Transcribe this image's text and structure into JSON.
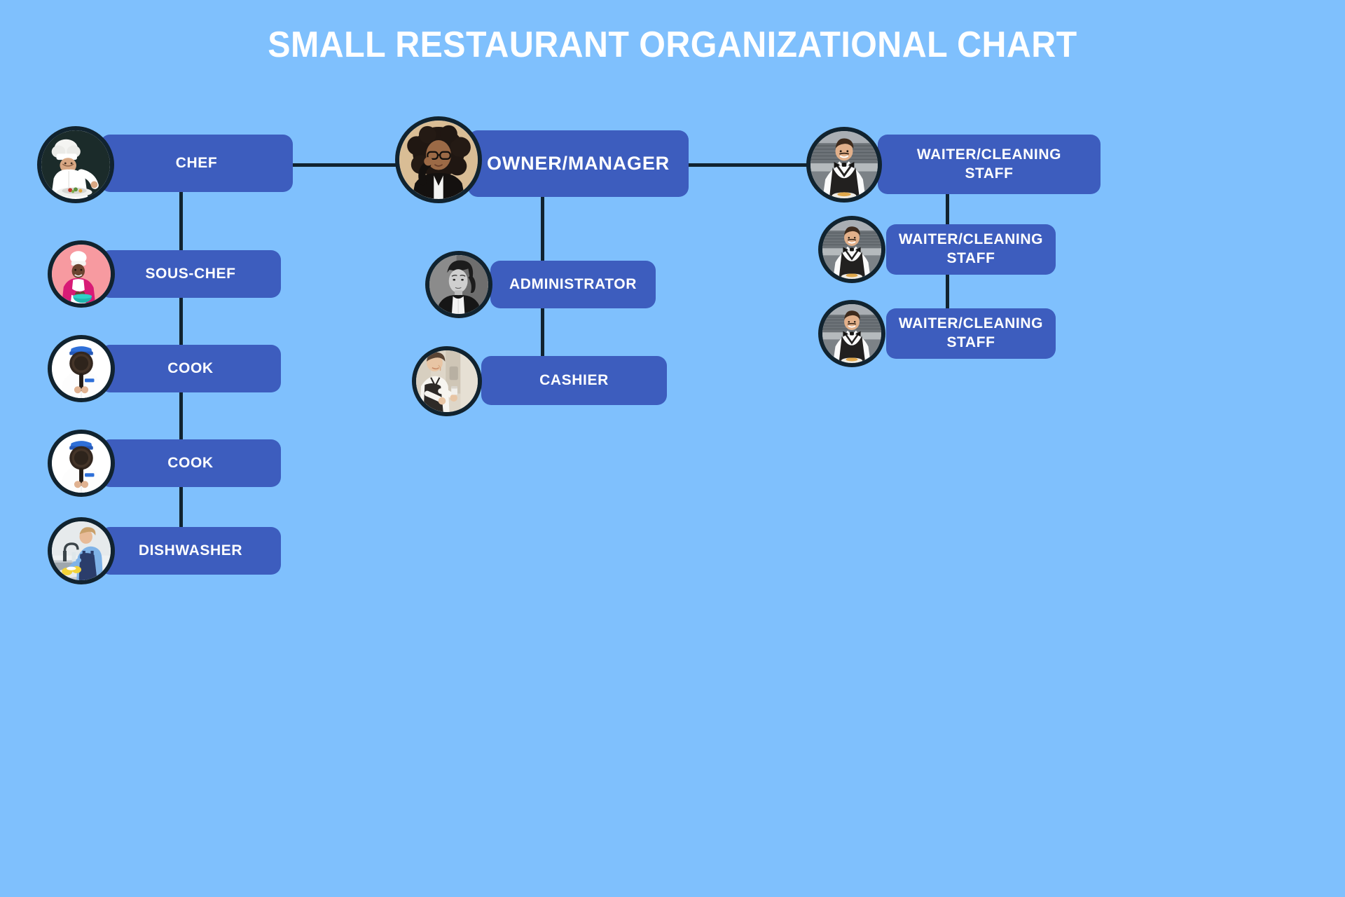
{
  "title": "SMALL RESTAURANT ORGANIZATIONAL CHART",
  "colors": {
    "background": "#7fc0fd",
    "box": "#3d5dbe",
    "connector": "#11232f",
    "label_text": "#ffffff",
    "title_text": "#ffffff",
    "avatar_ring": "#11232f"
  },
  "nodes": {
    "owner": {
      "label": "OWNER/MANAGER",
      "avatar": "owner-manager-photo"
    },
    "chef": {
      "label": "CHEF",
      "avatar": "chef-photo"
    },
    "sous_chef": {
      "label": "SOUS-CHEF",
      "avatar": "sous-chef-photo"
    },
    "cook1": {
      "label": "COOK",
      "avatar": "cook-photo"
    },
    "cook2": {
      "label": "COOK",
      "avatar": "cook-photo"
    },
    "dishwasher": {
      "label": "DISHWASHER",
      "avatar": "dishwasher-photo"
    },
    "administrator": {
      "label": "ADMINISTRATOR",
      "avatar": "administrator-photo"
    },
    "cashier": {
      "label": "CASHIER",
      "avatar": "cashier-photo"
    },
    "waiter1": {
      "label": "WAITER/CLEANING\nSTAFF",
      "avatar": "waiter-photo"
    },
    "waiter2": {
      "label": "WAITER/CLEANING\nSTAFF",
      "avatar": "waiter-photo"
    },
    "waiter3": {
      "label": "WAITER/CLEANING\nSTAFF",
      "avatar": "waiter-photo"
    }
  },
  "chart_data": {
    "type": "orgchart",
    "root": "OWNER/MANAGER",
    "branches": [
      {
        "head": "CHEF",
        "reports": [
          "SOUS-CHEF",
          "COOK",
          "COOK",
          "DISHWASHER"
        ]
      },
      {
        "head": "OWNER/MANAGER",
        "reports": [
          "ADMINISTRATOR",
          "CASHIER"
        ]
      },
      {
        "head": "WAITER/CLEANING STAFF",
        "reports": [
          "WAITER/CLEANING STAFF",
          "WAITER/CLEANING STAFF"
        ]
      }
    ],
    "total_positions": 11
  }
}
